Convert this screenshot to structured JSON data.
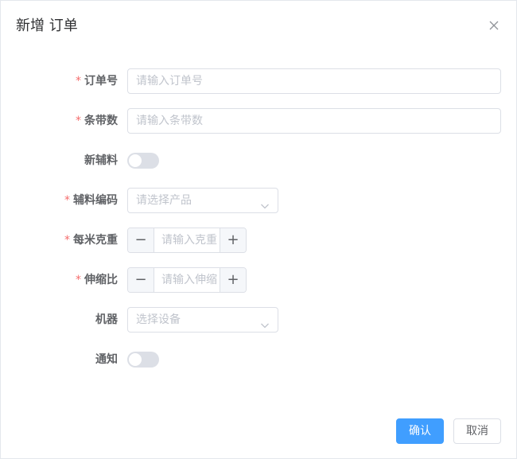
{
  "dialog": {
    "title": "新增 订单",
    "close_icon": "close-icon"
  },
  "form": {
    "order_no": {
      "label": "订单号",
      "required": "*",
      "placeholder": "请输入订单号",
      "value": ""
    },
    "strip_count": {
      "label": "条带数",
      "required": "*",
      "placeholder": "请输入条带数",
      "value": ""
    },
    "new_material": {
      "label": "新辅料",
      "enabled": false
    },
    "material_code": {
      "label": "辅料编码",
      "required": "*",
      "placeholder": "请选择产品",
      "value": ""
    },
    "gram_per_meter": {
      "label": "每米克重",
      "required": "*",
      "placeholder": "请输入克重",
      "minus": "−",
      "plus": "+"
    },
    "stretch_ratio": {
      "label": "伸缩比",
      "required": "*",
      "placeholder": "请输入伸缩",
      "minus": "−",
      "plus": "+"
    },
    "machine": {
      "label": "机器",
      "placeholder": "选择设备",
      "value": ""
    },
    "notify": {
      "label": "通知",
      "enabled": false
    }
  },
  "footer": {
    "confirm_label": "确认",
    "cancel_label": "取消"
  },
  "colors": {
    "primary": "#409eff",
    "required": "#f56c6c",
    "switch_off": "#dcdfe6"
  }
}
